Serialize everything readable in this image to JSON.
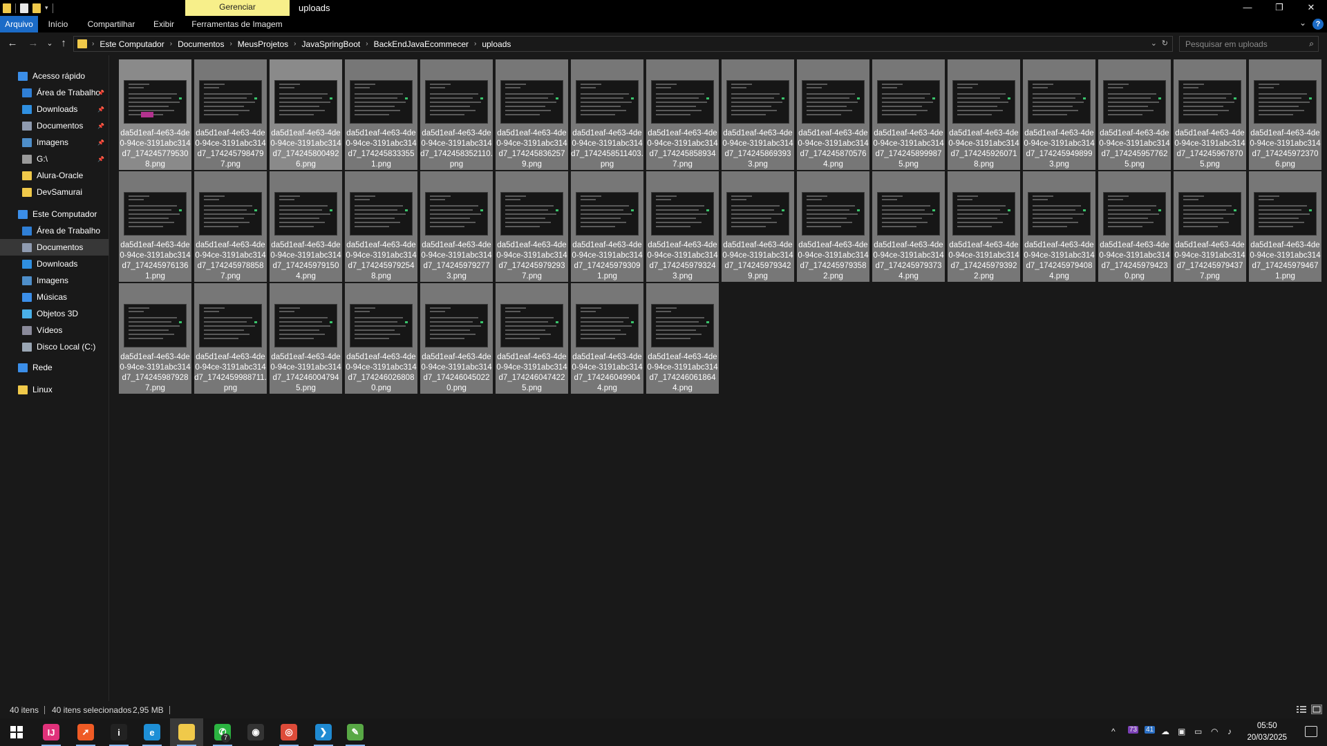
{
  "titlebar": {
    "manage_tab": "Gerenciar",
    "title": "uploads",
    "minimize": "—",
    "maximize": "❐",
    "close": "✕"
  },
  "ribbon": {
    "tabs": [
      "Arquivo",
      "Início",
      "Compartilhar",
      "Exibir",
      "Ferramentas de Imagem"
    ],
    "help": "?",
    "expand": "⌄"
  },
  "navbar": {
    "back": "←",
    "forward": "→",
    "recent": "⌄",
    "up": "↑",
    "breadcrumb": [
      "Este Computador",
      "Documentos",
      "MeusProjetos",
      "JavaSpringBoot",
      "BackEndJavaEcommecer",
      "uploads"
    ],
    "search_placeholder": "Pesquisar em uploads"
  },
  "sidebar": {
    "items": [
      {
        "label": "Acesso rápido",
        "icon": "star-icon",
        "color": "#3b8ee8",
        "pinned": false
      },
      {
        "label": "Área de Trabalho",
        "icon": "desktop-icon",
        "color": "#2f7fd6",
        "pinned": true
      },
      {
        "label": "Downloads",
        "icon": "download-icon",
        "color": "#2f8fe0",
        "pinned": true
      },
      {
        "label": "Documentos",
        "icon": "documents-icon",
        "color": "#8f9bb0",
        "pinned": true
      },
      {
        "label": "Imagens",
        "icon": "pictures-icon",
        "color": "#4e8ec9",
        "pinned": true
      },
      {
        "label": "G:\\",
        "icon": "drive-icon",
        "color": "#9a9a9a",
        "pinned": true
      },
      {
        "label": "Alura-Oracle",
        "icon": "folder-icon",
        "color": "#f0c94a",
        "pinned": false
      },
      {
        "label": "DevSamurai",
        "icon": "folder-icon",
        "color": "#f0c94a",
        "pinned": false
      },
      {
        "label": "Este Computador",
        "icon": "computer-icon",
        "color": "#3b8ee8",
        "pinned": false
      },
      {
        "label": "Área de Trabalho",
        "icon": "desktop-icon",
        "color": "#2f7fd6",
        "pinned": false
      },
      {
        "label": "Documentos",
        "icon": "documents-icon",
        "color": "#8f9bb0",
        "pinned": false
      },
      {
        "label": "Downloads",
        "icon": "download-icon",
        "color": "#2f8fe0",
        "pinned": false
      },
      {
        "label": "Imagens",
        "icon": "pictures-icon",
        "color": "#4e8ec9",
        "pinned": false
      },
      {
        "label": "Músicas",
        "icon": "music-icon",
        "color": "#3b8ee8",
        "pinned": false
      },
      {
        "label": "Objetos 3D",
        "icon": "cube-icon",
        "color": "#4ab0e8",
        "pinned": false
      },
      {
        "label": "Vídeos",
        "icon": "video-icon",
        "color": "#8a8a9a",
        "pinned": false
      },
      {
        "label": "Disco Local (C:)",
        "icon": "disk-icon",
        "color": "#9aa6b4",
        "pinned": false
      },
      {
        "label": "Rede",
        "icon": "network-icon",
        "color": "#3b8ee8",
        "pinned": false
      },
      {
        "label": "Linux",
        "icon": "penguin-icon",
        "color": "#f0c94a",
        "pinned": false
      }
    ]
  },
  "files": [
    "da5d1eaf-4e63-4de0-94ce-3191abc314d7_1742457795308.png",
    "da5d1eaf-4e63-4de0-94ce-3191abc314d7_1742457984797.png",
    "da5d1eaf-4e63-4de0-94ce-3191abc314d7_1742458004926.png",
    "da5d1eaf-4e63-4de0-94ce-3191abc314d7_1742458333551.png",
    "da5d1eaf-4e63-4de0-94ce-3191abc314d7_1742458352110.png",
    "da5d1eaf-4e63-4de0-94ce-3191abc314d7_1742458362579.png",
    "da5d1eaf-4e63-4de0-94ce-3191abc314d7_1742458511403.png",
    "da5d1eaf-4e63-4de0-94ce-3191abc314d7_1742458589347.png",
    "da5d1eaf-4e63-4de0-94ce-3191abc314d7_1742458693933.png",
    "da5d1eaf-4e63-4de0-94ce-3191abc314d7_1742458705764.png",
    "da5d1eaf-4e63-4de0-94ce-3191abc314d7_1742458999875.png",
    "da5d1eaf-4e63-4de0-94ce-3191abc314d7_1742459260718.png",
    "da5d1eaf-4e63-4de0-94ce-3191abc314d7_1742459498993.png",
    "da5d1eaf-4e63-4de0-94ce-3191abc314d7_1742459577625.png",
    "da5d1eaf-4e63-4de0-94ce-3191abc314d7_1742459678705.png",
    "da5d1eaf-4e63-4de0-94ce-3191abc314d7_1742459723706.png",
    "da5d1eaf-4e63-4de0-94ce-3191abc314d7_1742459761361.png",
    "da5d1eaf-4e63-4de0-94ce-3191abc314d7_1742459788587.png",
    "da5d1eaf-4e63-4de0-94ce-3191abc314d7_1742459791504.png",
    "da5d1eaf-4e63-4de0-94ce-3191abc314d7_1742459792548.png",
    "da5d1eaf-4e63-4de0-94ce-3191abc314d7_1742459792773.png",
    "da5d1eaf-4e63-4de0-94ce-3191abc314d7_1742459792937.png",
    "da5d1eaf-4e63-4de0-94ce-3191abc314d7_1742459793091.png",
    "da5d1eaf-4e63-4de0-94ce-3191abc314d7_1742459793243.png",
    "da5d1eaf-4e63-4de0-94ce-3191abc314d7_1742459793429.png",
    "da5d1eaf-4e63-4de0-94ce-3191abc314d7_1742459793582.png",
    "da5d1eaf-4e63-4de0-94ce-3191abc314d7_1742459793734.png",
    "da5d1eaf-4e63-4de0-94ce-3191abc314d7_1742459793922.png",
    "da5d1eaf-4e63-4de0-94ce-3191abc314d7_1742459794084.png",
    "da5d1eaf-4e63-4de0-94ce-3191abc314d7_1742459794230.png",
    "da5d1eaf-4e63-4de0-94ce-3191abc314d7_1742459794377.png",
    "da5d1eaf-4e63-4de0-94ce-3191abc314d7_1742459794671.png",
    "da5d1eaf-4e63-4de0-94ce-3191abc314d7_1742459879287.png",
    "da5d1eaf-4e63-4de0-94ce-3191abc314d7_1742459988711.png",
    "da5d1eaf-4e63-4de0-94ce-3191abc314d7_1742460047945.png",
    "da5d1eaf-4e63-4de0-94ce-3191abc314d7_1742460268080.png",
    "da5d1eaf-4e63-4de0-94ce-3191abc314d7_1742460450220.png",
    "da5d1eaf-4e63-4de0-94ce-3191abc314d7_1742460474225.png",
    "da5d1eaf-4e63-4de0-94ce-3191abc314d7_1742460499044.png",
    "da5d1eaf-4e63-4de0-94ce-3191abc314d7_1742460618644.png"
  ],
  "status": {
    "count": "40 itens",
    "selection": "40 itens selecionados",
    "size": "2,95 MB"
  },
  "taskbar": {
    "apps": [
      {
        "name": "start-icon",
        "label": "",
        "color": "#ffffff"
      },
      {
        "name": "intellij-icon",
        "label": "IJ",
        "color": "#e0317a"
      },
      {
        "name": "postman-icon",
        "label": "➚",
        "color": "#ef5b25"
      },
      {
        "name": "app-circle-icon",
        "label": "i",
        "color": "#222222"
      },
      {
        "name": "edge-icon",
        "label": "e",
        "color": "#1e8fd6"
      },
      {
        "name": "file-explorer-icon",
        "label": "",
        "color": "#f0c94a"
      },
      {
        "name": "whatsapp-icon",
        "label": "✆",
        "color": "#2bb441"
      },
      {
        "name": "github-icon",
        "label": "◉",
        "color": "#333333"
      },
      {
        "name": "chrome-icon",
        "label": "◎",
        "color": "#dd4b39"
      },
      {
        "name": "vscode-icon",
        "label": "❯",
        "color": "#1f8ad2"
      },
      {
        "name": "notepad-icon",
        "label": "✎",
        "color": "#58a845"
      }
    ],
    "whatsapp_badge": "7",
    "tray_badges": [
      "73",
      "41"
    ],
    "time": "05:50",
    "date": "20/03/2025"
  }
}
